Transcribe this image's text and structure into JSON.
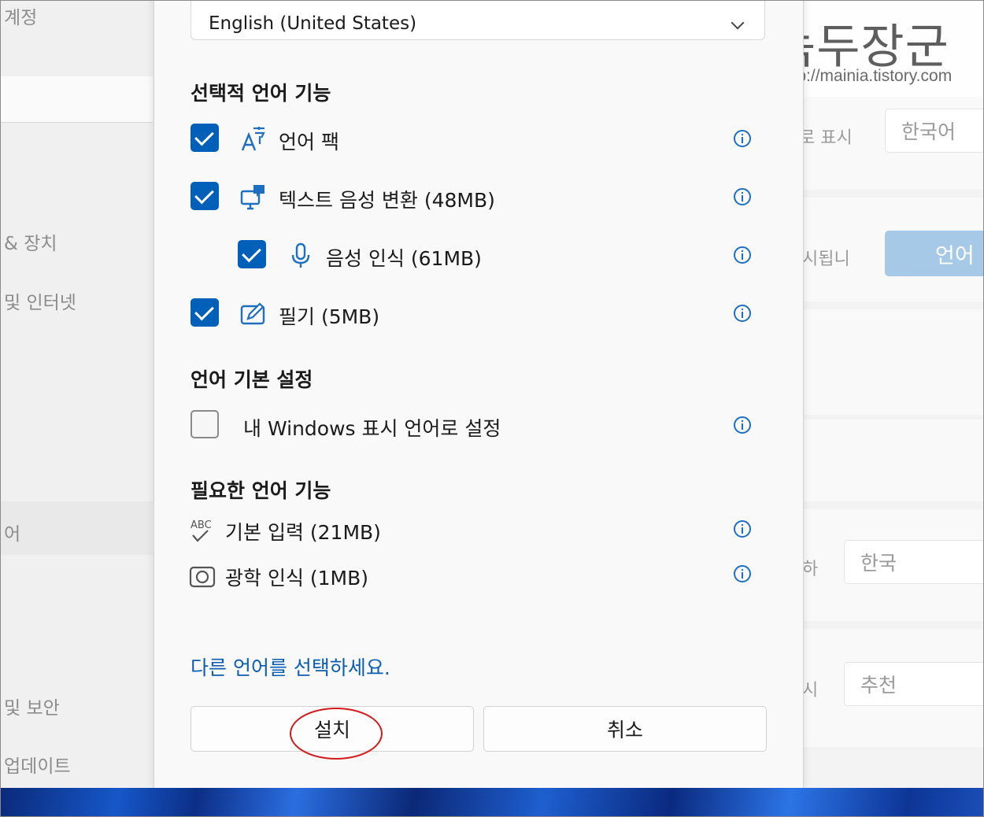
{
  "sidebar": {
    "items": [
      "계정",
      "& 장치",
      "및 인터넷",
      "어",
      "및 보안",
      "업데이트"
    ]
  },
  "background_right": {
    "display_label": "로 표시",
    "display_value": "한국어",
    "notice_text": "시됩니",
    "language_button": "언어",
    "region_label": "하",
    "region_value": "한국",
    "format_label": "시",
    "format_value": "추천"
  },
  "watermark": {
    "title": "녹두장군",
    "url": "http://mainia.tistory.com"
  },
  "dialog": {
    "language_select": {
      "value": "English (United States)"
    },
    "optional_section": "선택적 언어 기능",
    "optional_features": [
      {
        "label": "언어 팩",
        "checked": true,
        "icon": "language-pack-icon"
      },
      {
        "label": "텍스트 음성 변환 (48MB)",
        "checked": true,
        "icon": "text-to-speech-icon"
      },
      {
        "label": "음성 인식 (61MB)",
        "checked": true,
        "icon": "microphone-icon"
      },
      {
        "label": "필기 (5MB)",
        "checked": true,
        "icon": "handwriting-icon"
      }
    ],
    "preference_section": "언어 기본 설정",
    "preference_item": {
      "label": "내 Windows 표시 언어로 설정",
      "checked": false
    },
    "required_section": "필요한 언어 기능",
    "required_features": [
      {
        "label": "기본 입력 (21MB)",
        "icon": "spellcheck-icon"
      },
      {
        "label": "광학 인식 (1MB)",
        "icon": "ocr-camera-icon"
      }
    ],
    "choose_other_link": "다른 언어를 선택하세요.",
    "install_button": "설치",
    "cancel_button": "취소"
  },
  "colors": {
    "accent": "#005fb8",
    "link": "#0a5db0",
    "annotation_ring": "#d31a1a"
  }
}
